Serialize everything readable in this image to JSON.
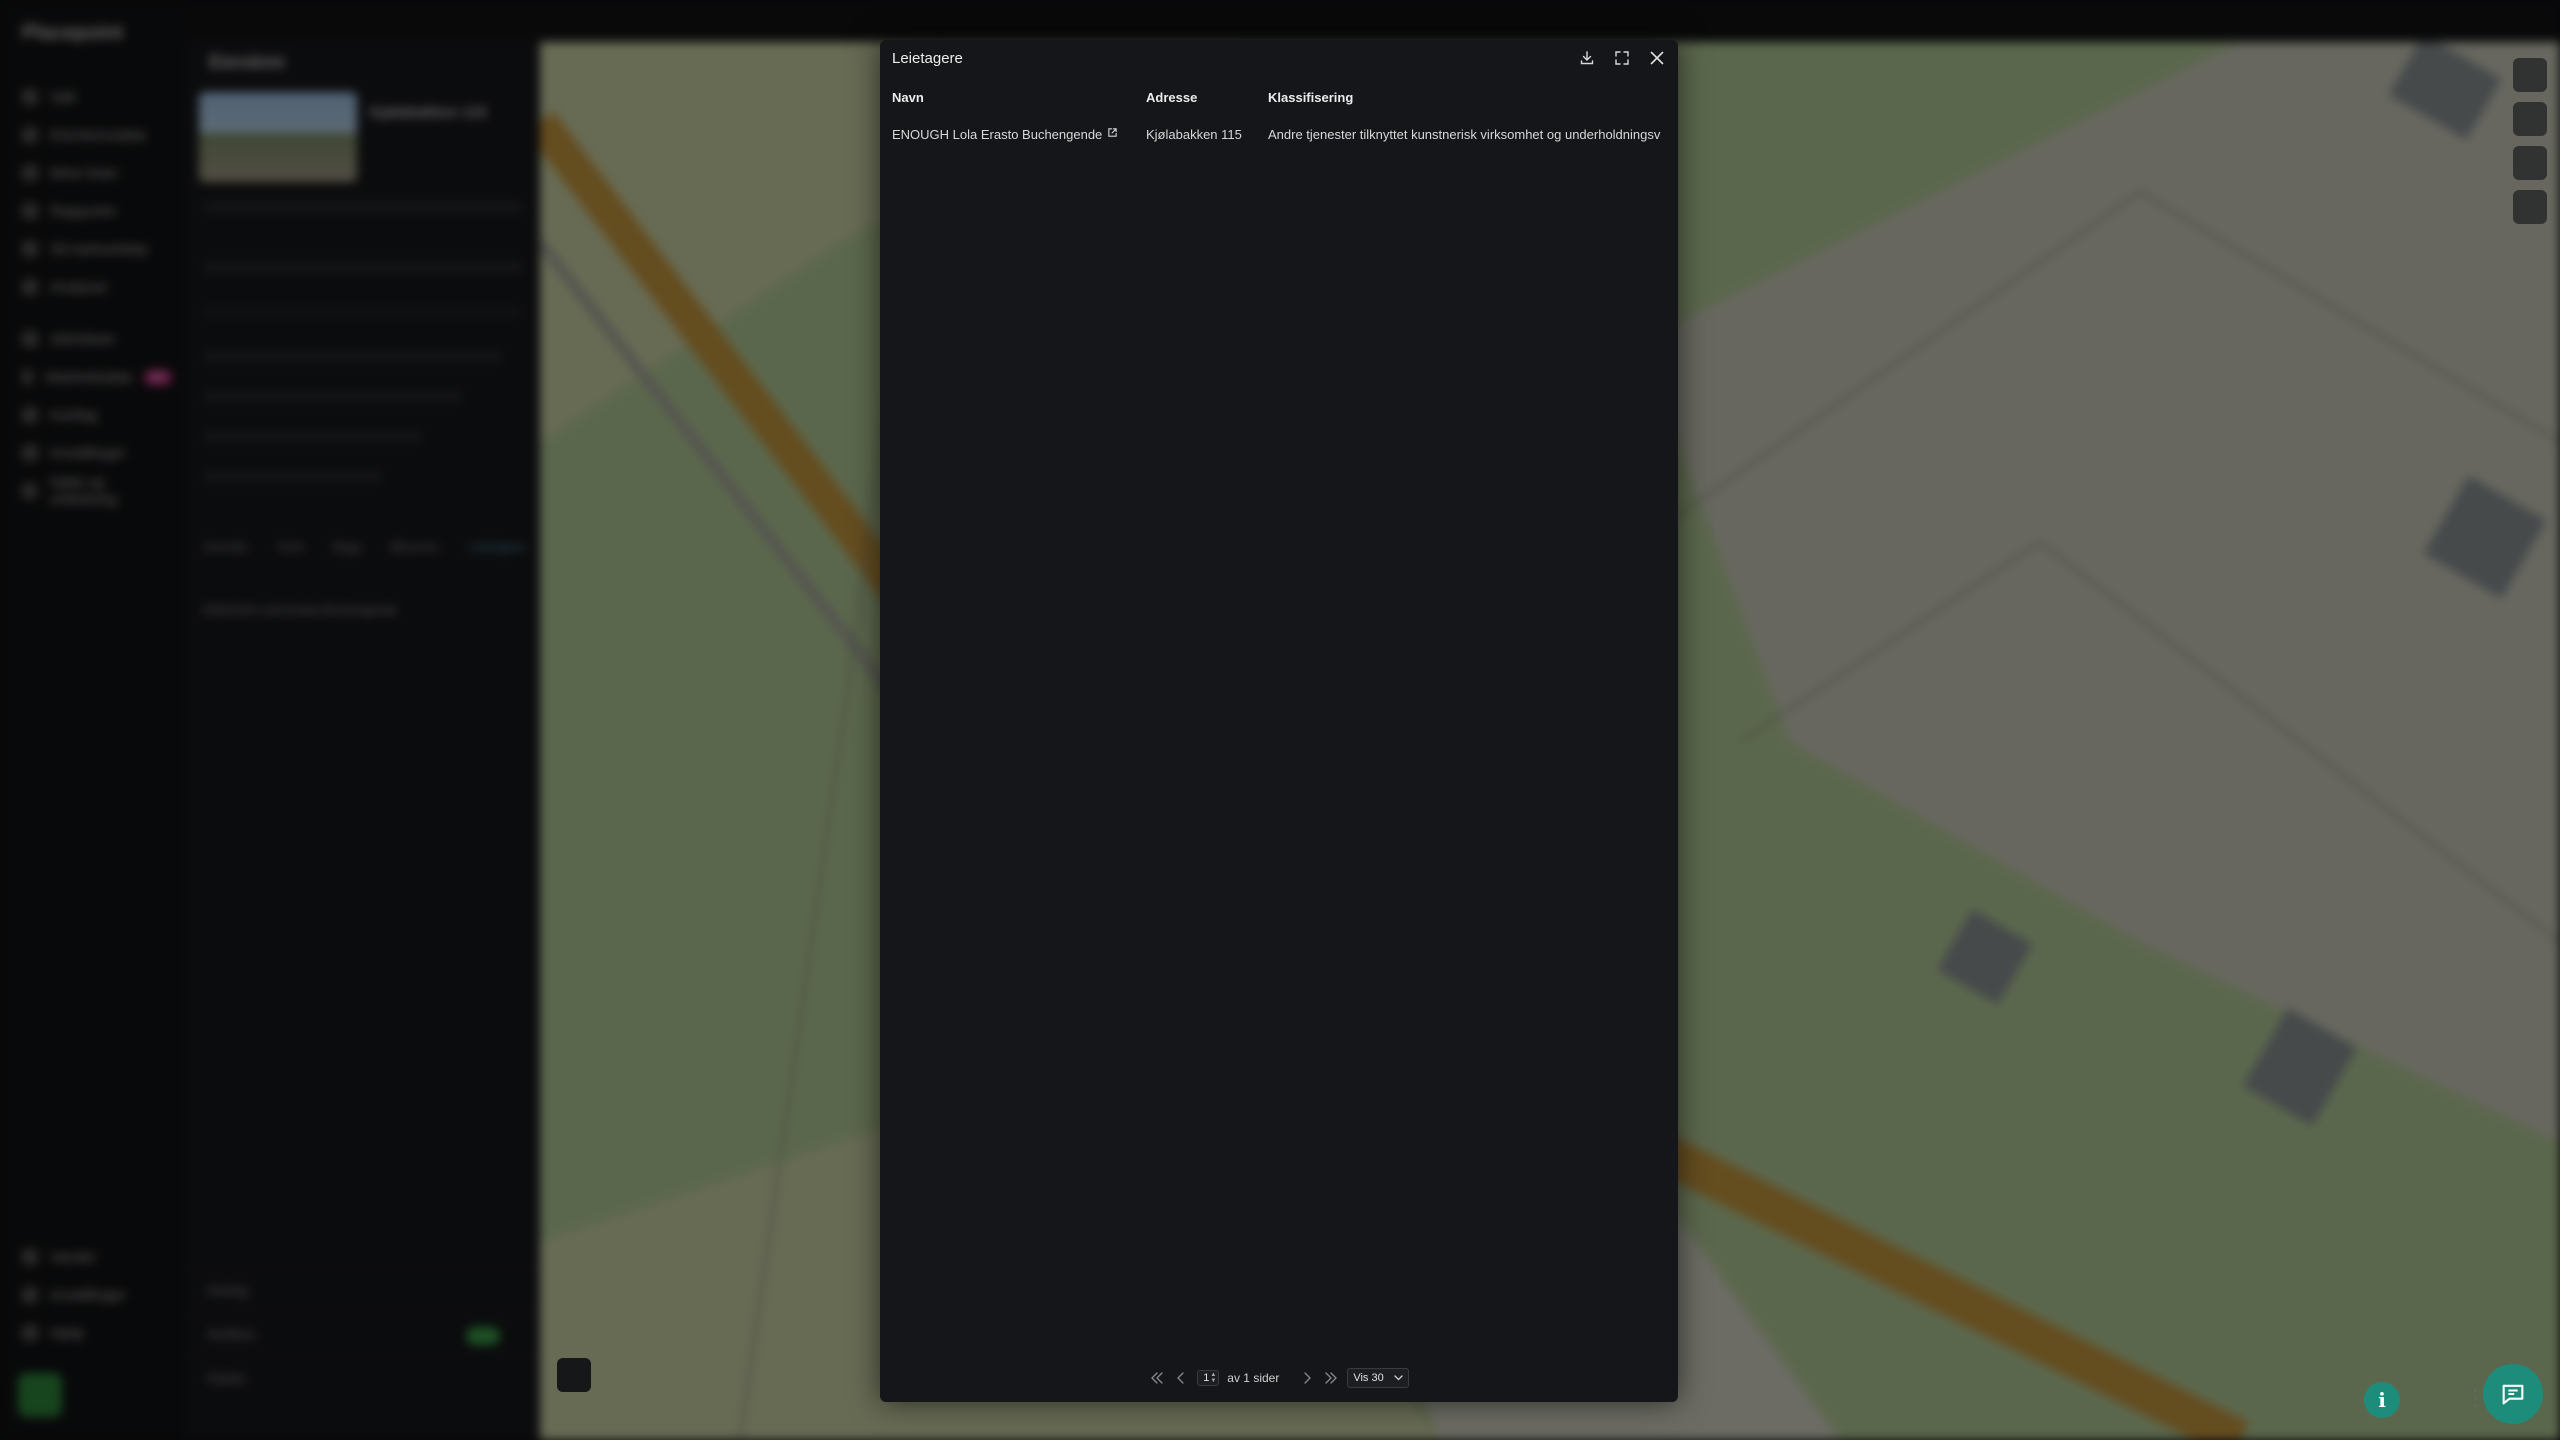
{
  "background": {
    "app_name": "Placepoint",
    "nav_items": [
      {
        "label": "Søk"
      },
      {
        "label": "Eiendomsdata"
      },
      {
        "label": "Mine lister"
      },
      {
        "label": "Rapporter"
      },
      {
        "label": "3D-kartverktøy"
      },
      {
        "label": "Analyser"
      },
      {
        "label": "Aktiviteter"
      },
      {
        "label": "Markedsdata",
        "badge": "NY"
      },
      {
        "label": "Kartlag"
      },
      {
        "label": "Innstillinger"
      },
      {
        "label": "Hjelp og veiledning"
      }
    ],
    "bottom_nav": [
      {
        "label": "Varsler"
      },
      {
        "label": "Innstillinger"
      },
      {
        "label": "Hjelp"
      }
    ],
    "panel_title": "Eiendom",
    "panel_property": "Kjølabakken 115",
    "panel_tabs": [
      "Oversikt",
      "Tomt",
      "Bygg",
      "Økonomi",
      "Leietagere"
    ],
    "panel_entry": "ENOUGH Lola Erasto Buchengende",
    "panel_footer": [
      "Kartlag",
      "Skråfoto",
      "Flyfoto"
    ]
  },
  "modal": {
    "title": "Leietagere",
    "columns": [
      "Navn",
      "Adresse",
      "Klassifisering"
    ],
    "rows": [
      {
        "name": "ENOUGH Lola Erasto Buchengende",
        "address": "Kjølabakken 115",
        "classification": "Andre tjenester tilknyttet kunstnerisk virksomhet og underholdningsv"
      }
    ],
    "pagination": {
      "current_page": "1",
      "of_pages_text": "av 1 sider",
      "per_page": "Vis 30"
    }
  },
  "icons": {
    "download": "download-icon",
    "fullscreen": "fullscreen-icon",
    "close": "close-icon",
    "external_link": "external-link-icon",
    "first_page": "first-page-icon",
    "prev_page": "prev-page-icon",
    "next_page": "next-page-icon",
    "last_page": "last-page-icon",
    "info": "info-icon",
    "chat": "chat-icon"
  },
  "info_button_label": "i"
}
